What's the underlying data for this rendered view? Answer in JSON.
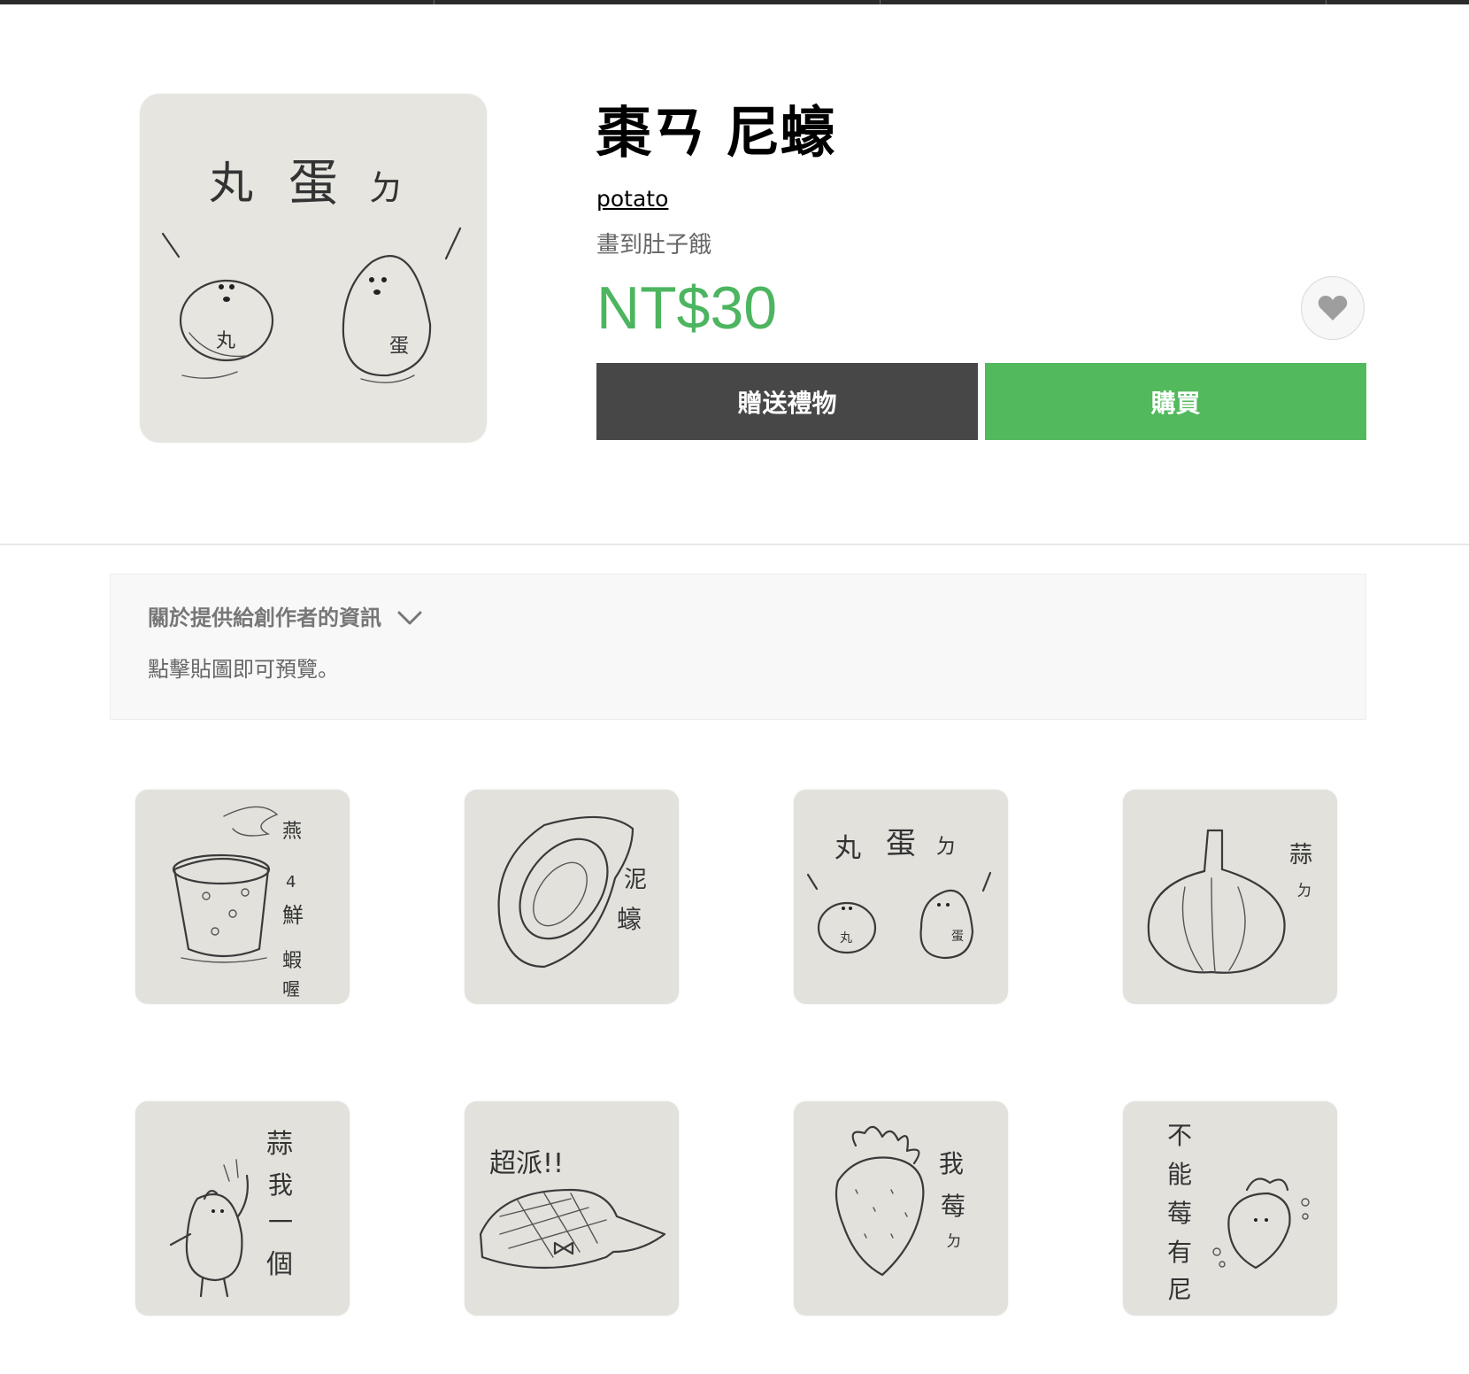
{
  "product": {
    "title": "棗ㄢ 尼蠔",
    "author": "potato",
    "description": "畫到肚子餓",
    "price": "NT$30"
  },
  "actions": {
    "gift_label": "贈送禮物",
    "buy_label": "購買",
    "favorite_icon": "heart-icon"
  },
  "info": {
    "title": "關於提供給創作者的資訊",
    "note": "點擊貼圖即可預覽。"
  },
  "stickers": [
    {
      "name": "sticker-soup",
      "text": "燕4鮮蝦喔"
    },
    {
      "name": "sticker-oyster",
      "text": "泥蠔"
    },
    {
      "name": "sticker-meatball",
      "text": "丸蛋ㄉ"
    },
    {
      "name": "sticker-garlic",
      "text": "蒜ㄉ"
    },
    {
      "name": "sticker-garlic-char",
      "text": "蒜我一個"
    },
    {
      "name": "sticker-pastry",
      "text": "超派!!"
    },
    {
      "name": "sticker-strawberry",
      "text": "我莓ㄉ"
    },
    {
      "name": "sticker-strawberry-small",
      "text": "不能莓有尼"
    }
  ],
  "colors": {
    "price": "#4db560",
    "buy": "#52b95c",
    "gift": "#474747"
  }
}
